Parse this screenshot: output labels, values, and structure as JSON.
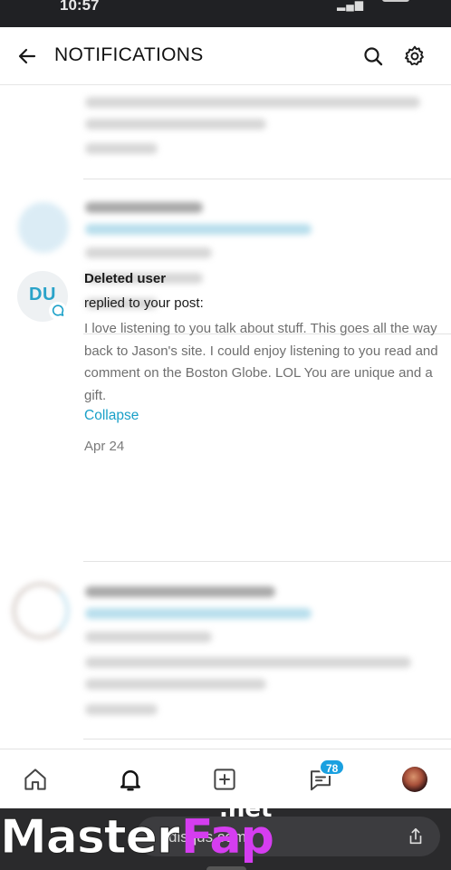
{
  "status_bar": {
    "time": "10:57",
    "signal": "▂▄▆"
  },
  "header": {
    "title": "NOTIFICATIONS",
    "back_icon": "arrow-left-icon",
    "search_icon": "search-icon",
    "settings_icon": "gear-icon"
  },
  "notification": {
    "avatar_initials": "DU",
    "user": "Deleted user",
    "action": "replied to your post:",
    "body": "I love listening to you talk about stuff. This goes all the way back to Jason's site. I could enjoy listening to you read and comment on the Boston Globe. LOL You are unique and a gift.",
    "collapse_label": "Collapse",
    "date": "Apr 24"
  },
  "tabbar": {
    "items": [
      "home-icon",
      "bell-icon",
      "plus-square-icon",
      "chat-icon",
      "profile-avatar"
    ],
    "chat_badge": "78"
  },
  "browser": {
    "url": "disqus.com",
    "share_icon": "share-icon"
  },
  "watermark": {
    "text_1": "Master",
    "text_2": "Fap",
    "text_3": ".net"
  },
  "colors": {
    "accent": "#1aa0c8",
    "badge": "#1aa0e0",
    "text_muted": "#6f6f6f"
  }
}
